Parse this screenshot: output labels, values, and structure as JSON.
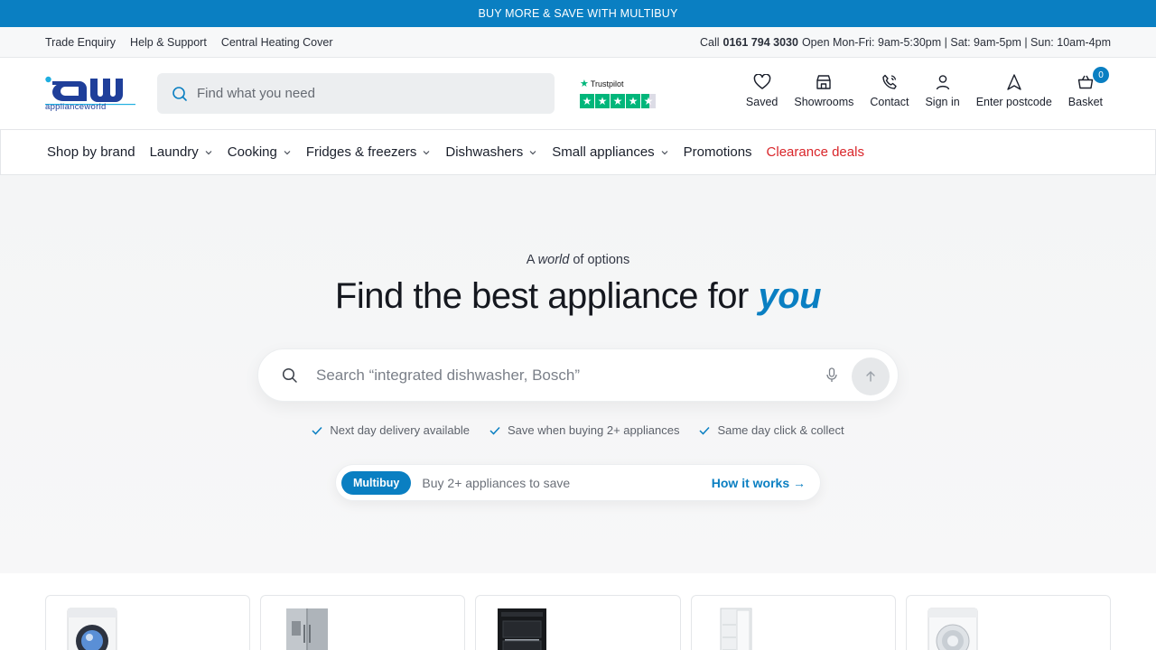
{
  "promo": {
    "text": "BUY MORE & SAVE WITH MULTIBUY"
  },
  "utility": {
    "links": [
      "Trade Enquiry",
      "Help & Support",
      "Central Heating Cover"
    ],
    "call_prefix": "Call",
    "phone": "0161 794 3030",
    "hours": "Open Mon-Fri: 9am-5:30pm | Sat: 9am-5pm | Sun: 10am-4pm"
  },
  "header": {
    "logo_text": "applianceworld",
    "search_placeholder": "Find what you need",
    "trustpilot_label": "Trustpilot",
    "trustpilot_rating_stars": 4.5,
    "actions": [
      {
        "label": "Saved",
        "icon": "heart-icon"
      },
      {
        "label": "Showrooms",
        "icon": "store-icon"
      },
      {
        "label": "Contact",
        "icon": "phone-icon"
      },
      {
        "label": "Sign in",
        "icon": "user-icon"
      },
      {
        "label": "Enter postcode",
        "icon": "location-arrow-icon"
      },
      {
        "label": "Basket",
        "icon": "basket-icon"
      }
    ],
    "basket_count": "0"
  },
  "nav": {
    "items": [
      {
        "label": "Shop by brand",
        "dropdown": false
      },
      {
        "label": "Laundry",
        "dropdown": true
      },
      {
        "label": "Cooking",
        "dropdown": true
      },
      {
        "label": "Fridges & freezers",
        "dropdown": true
      },
      {
        "label": "Dishwashers",
        "dropdown": true
      },
      {
        "label": "Small appliances",
        "dropdown": true
      },
      {
        "label": "Promotions",
        "dropdown": false
      },
      {
        "label": "Clearance deals",
        "dropdown": false
      }
    ]
  },
  "hero": {
    "kicker_a": "A",
    "kicker_world": "world",
    "kicker_rest": "of options",
    "title_main": "Find the best appliance for",
    "title_accent": "you",
    "search_placeholder": "Search “integrated dishwasher, Bosch”",
    "benefits": [
      "Next day delivery available",
      "Save when buying 2+ appliances",
      "Same day click & collect"
    ],
    "multibuy_pill": "Multibuy",
    "multibuy_text": "Buy 2+ appliances to save",
    "multibuy_link": "How it works →"
  },
  "products": [
    {
      "name": "washing-machine",
      "icon": "washing-machine-image"
    },
    {
      "name": "american-fridge-freezer",
      "icon": "fridge-freezer-image"
    },
    {
      "name": "built-in-oven",
      "icon": "oven-image"
    },
    {
      "name": "fridge",
      "icon": "fridge-image"
    },
    {
      "name": "tumble-dryer",
      "icon": "dryer-image"
    }
  ],
  "colors": {
    "brand_blue": "#0a7fc2",
    "logo_navy": "#1f3f9a",
    "clearance_red": "#d9252a",
    "trustpilot_green": "#00b67a"
  }
}
